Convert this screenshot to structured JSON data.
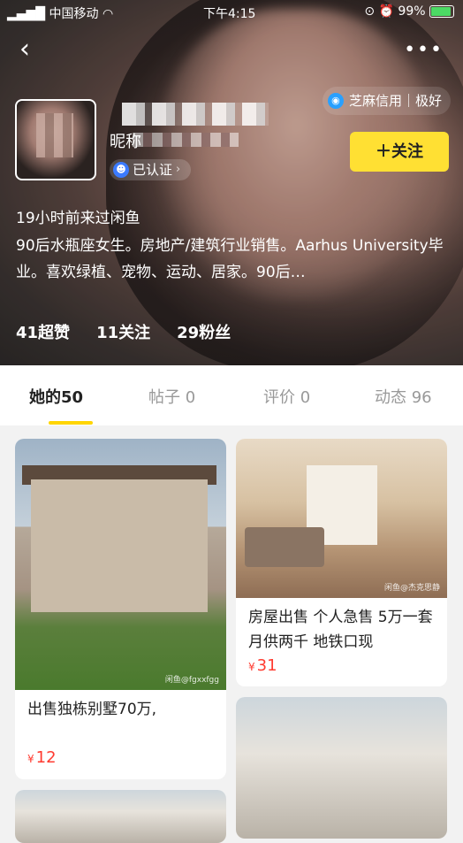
{
  "status_bar": {
    "carrier": "中国移动",
    "time": "下午4:15",
    "battery": "99%"
  },
  "header": {
    "credit_label": "芝麻信用｜极好",
    "nickname_prefix": "昵称",
    "verified_label": "已认证",
    "follow_label": "＋关注",
    "last_seen": "19小时前来过闲鱼",
    "bio": "90后水瓶座女生。房地产/建筑行业销售。Aarhus University毕业。喜欢绿植、宠物、运动、居家。90后…",
    "stats": {
      "likes": "41超赞",
      "following": "11关注",
      "fans": "29粉丝"
    }
  },
  "tabs": [
    {
      "label": "她的50"
    },
    {
      "label": "帖子 0"
    },
    {
      "label": "评价 0"
    },
    {
      "label": "动态 96"
    }
  ],
  "items": [
    {
      "title": "出售独栋别墅70万,",
      "currency": "¥",
      "price": "12",
      "watermark": "闲鱼@fgxxfgg"
    },
    {
      "title": "房屋出售 个人急售 5万一套 月供两千 地铁口现",
      "currency": "¥",
      "price": "31",
      "watermark": "闲鱼@杰克思静"
    }
  ],
  "colors": {
    "accent": "#ffe033",
    "price": "#ff3b30",
    "tab_underline": "#ffd500"
  },
  "icons": [
    "back-icon",
    "more-icon",
    "sesame-credit-icon",
    "verified-icon",
    "wifi-icon",
    "battery-icon"
  ]
}
